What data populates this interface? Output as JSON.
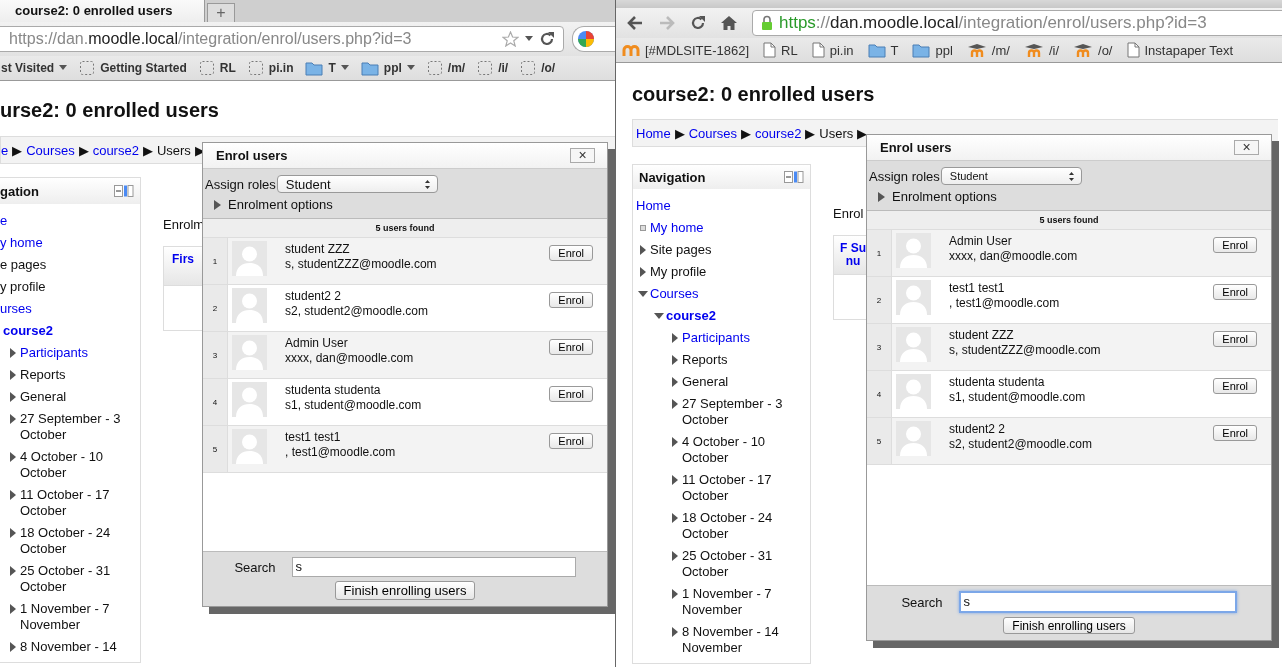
{
  "windows": [
    {
      "tab": {
        "title": "course2: 0 enrolled users"
      },
      "new_tab": "+",
      "address": {
        "secure": false,
        "parts": [
          {
            "text": "https://dan.",
            "kind": "dim"
          },
          {
            "text": "moodle.local",
            "kind": "host"
          },
          {
            "text": "/integration/enrol/users.php?id=3",
            "kind": "dim"
          }
        ]
      },
      "bookmarks": [
        {
          "label": "st Visited",
          "kind": "plain",
          "menu": true
        },
        {
          "label": "Getting Started",
          "kind": "blank",
          "menu": false
        },
        {
          "label": "RL",
          "kind": "blank",
          "menu": false
        },
        {
          "label": "pi.in",
          "kind": "blank",
          "menu": false
        },
        {
          "label": "T",
          "kind": "folder",
          "menu": true
        },
        {
          "label": "ppl",
          "kind": "folder",
          "menu": true
        },
        {
          "label": "/m/",
          "kind": "blank",
          "menu": false
        },
        {
          "label": "/i/",
          "kind": "blank",
          "menu": false
        },
        {
          "label": "/o/",
          "kind": "blank",
          "menu": false
        }
      ],
      "page": {
        "title": "urse2: 0 enrolled users",
        "breadcrumb": {
          "separator": "▶",
          "trailing": true,
          "items": [
            {
              "label": "e",
              "link": true
            },
            {
              "label": "Courses",
              "link": true
            },
            {
              "label": "course2",
              "link": true
            },
            {
              "label": "Users",
              "link": false
            }
          ]
        },
        "nav": {
          "title": "gation",
          "items": [
            {
              "label": "e",
              "kind": "plain",
              "link": true,
              "current": false
            },
            {
              "label": "y home",
              "kind": "plain",
              "link": true,
              "current": false
            },
            {
              "label": "e pages",
              "kind": "plain",
              "link": false,
              "current": false
            },
            {
              "label": "y profile",
              "kind": "plain",
              "link": false,
              "current": false
            },
            {
              "label": "urses",
              "kind": "plain",
              "link": true,
              "current": false,
              "children": [
                {
                  "label": "course2",
                  "kind": "plain",
                  "link": true,
                  "current": true,
                  "children": [
                    {
                      "label": "Participants",
                      "kind": "branch",
                      "expanded": false,
                      "link": true,
                      "current": false
                    },
                    {
                      "label": "Reports",
                      "kind": "branch",
                      "expanded": false,
                      "link": false,
                      "current": false
                    },
                    {
                      "label": "General",
                      "kind": "branch",
                      "expanded": false,
                      "link": false,
                      "current": false
                    },
                    {
                      "label": "27 September - 3 October",
                      "kind": "branch",
                      "expanded": false,
                      "link": false,
                      "current": false
                    },
                    {
                      "label": "4 October - 10 October",
                      "kind": "branch",
                      "expanded": false,
                      "link": false,
                      "current": false
                    },
                    {
                      "label": "11 October - 17 October",
                      "kind": "branch",
                      "expanded": false,
                      "link": false,
                      "current": false
                    },
                    {
                      "label": "18 October - 24 October",
                      "kind": "branch",
                      "expanded": false,
                      "link": false,
                      "current": false
                    },
                    {
                      "label": "25 October - 31 October",
                      "kind": "branch",
                      "expanded": false,
                      "link": false,
                      "current": false
                    },
                    {
                      "label": "1 November - 7 November",
                      "kind": "branch",
                      "expanded": false,
                      "link": false,
                      "current": false
                    },
                    {
                      "label": "8 November - 14",
                      "kind": "branch",
                      "expanded": false,
                      "link": false,
                      "current": false
                    }
                  ]
                }
              ]
            }
          ]
        },
        "content_label": "Enrolm",
        "table_header": "Firs"
      },
      "dialog": {
        "title": "Enrol users",
        "close": "×",
        "assign_label": "Assign roles",
        "role": "Student",
        "options_label": "Enrolment options",
        "options_expanded": false,
        "found": "5 users found",
        "users": [
          {
            "number": "1",
            "name": "student ZZZ",
            "detail": "s, studentZZZ@moodle.com",
            "action": "Enrol"
          },
          {
            "number": "2",
            "name": "student2 2",
            "detail": "s2, student2@moodle.com",
            "action": "Enrol"
          },
          {
            "number": "3",
            "name": "Admin User",
            "detail": "xxxx, dan@moodle.com",
            "action": "Enrol"
          },
          {
            "number": "4",
            "name": "studenta studenta",
            "detail": "s1, student@moodle.com",
            "action": "Enrol"
          },
          {
            "number": "5",
            "name": "test1 test1",
            "detail": ", test1@moodle.com",
            "action": "Enrol"
          }
        ],
        "search_label": "Search",
        "search_value": "s",
        "search_focused": false,
        "finish": "Finish enrolling users"
      }
    },
    {
      "forward_disabled": true,
      "address": {
        "secure": true,
        "parts": [
          {
            "text": "https",
            "kind": "secure"
          },
          {
            "text": "://",
            "kind": "dim"
          },
          {
            "text": "dan.moodle.local",
            "kind": "host"
          },
          {
            "text": "/integration/enrol/users.php?id=3",
            "kind": "dim"
          }
        ]
      },
      "bookmarks": [
        {
          "label": "[#MDLSITE-1862]",
          "kind": "logo",
          "menu": false
        },
        {
          "label": "RL",
          "kind": "page",
          "menu": false
        },
        {
          "label": "pi.in",
          "kind": "page",
          "menu": false
        },
        {
          "label": "T",
          "kind": "folder",
          "menu": false
        },
        {
          "label": "ppl",
          "kind": "folder",
          "menu": false
        },
        {
          "label": "/m/",
          "kind": "hat",
          "menu": false
        },
        {
          "label": "/i/",
          "kind": "hat",
          "menu": false
        },
        {
          "label": "/o/",
          "kind": "hat",
          "menu": false
        },
        {
          "label": "Instapaper Text",
          "kind": "page",
          "menu": false
        }
      ],
      "page": {
        "title": "course2: 0 enrolled users",
        "breadcrumb": {
          "separator": "▶",
          "trailing": true,
          "items": [
            {
              "label": "Home",
              "link": true
            },
            {
              "label": "Courses",
              "link": true
            },
            {
              "label": "course2",
              "link": true
            },
            {
              "label": "Users",
              "link": false
            }
          ]
        },
        "nav": {
          "title": "Navigation",
          "items": [
            {
              "label": "Home",
              "kind": "plain",
              "link": true,
              "current": false
            },
            {
              "label": "My home",
              "kind": "leaf",
              "link": true,
              "current": false
            },
            {
              "label": "Site pages",
              "kind": "branch",
              "expanded": false,
              "link": false,
              "current": false
            },
            {
              "label": "My profile",
              "kind": "branch",
              "expanded": false,
              "link": false,
              "current": false
            },
            {
              "label": "Courses",
              "kind": "branch",
              "expanded": true,
              "link": true,
              "current": false,
              "children": [
                {
                  "label": "course2",
                  "kind": "branch",
                  "expanded": true,
                  "link": true,
                  "current": true,
                  "children": [
                    {
                      "label": "Participants",
                      "kind": "branch",
                      "expanded": false,
                      "link": true,
                      "current": false
                    },
                    {
                      "label": "Reports",
                      "kind": "branch",
                      "expanded": false,
                      "link": false,
                      "current": false
                    },
                    {
                      "label": "General",
                      "kind": "branch",
                      "expanded": false,
                      "link": false,
                      "current": false
                    },
                    {
                      "label": "27 September - 3 October",
                      "kind": "branch",
                      "expanded": false,
                      "link": false,
                      "current": false
                    },
                    {
                      "label": "4 October - 10 October",
                      "kind": "branch",
                      "expanded": false,
                      "link": false,
                      "current": false
                    },
                    {
                      "label": "11 October - 17 October",
                      "kind": "branch",
                      "expanded": false,
                      "link": false,
                      "current": false
                    },
                    {
                      "label": "18 October - 24 October",
                      "kind": "branch",
                      "expanded": false,
                      "link": false,
                      "current": false
                    },
                    {
                      "label": "25 October - 31 October",
                      "kind": "branch",
                      "expanded": false,
                      "link": false,
                      "current": false
                    },
                    {
                      "label": "1 November - 7 November",
                      "kind": "branch",
                      "expanded": false,
                      "link": false,
                      "current": false
                    },
                    {
                      "label": "8 November - 14 November",
                      "kind": "branch",
                      "expanded": false,
                      "link": false,
                      "current": false
                    }
                  ]
                }
              ]
            }
          ]
        },
        "content_label": "Enrol",
        "table_header": "F Su nu"
      },
      "dialog": {
        "title": "Enrol users",
        "close": "×",
        "assign_label": "Assign roles",
        "role": "Student",
        "options_label": "Enrolment options",
        "options_expanded": false,
        "found": "5 users found",
        "users": [
          {
            "number": "1",
            "name": "Admin User",
            "detail": "xxxx, dan@moodle.com",
            "action": "Enrol"
          },
          {
            "number": "2",
            "name": "test1 test1",
            "detail": ", test1@moodle.com",
            "action": "Enrol"
          },
          {
            "number": "3",
            "name": "student ZZZ",
            "detail": "s, studentZZZ@moodle.com",
            "action": "Enrol"
          },
          {
            "number": "4",
            "name": "studenta studenta",
            "detail": "s1, student@moodle.com",
            "action": "Enrol"
          },
          {
            "number": "5",
            "name": "student2 2",
            "detail": "s2, student2@moodle.com",
            "action": "Enrol"
          }
        ],
        "search_label": "Search",
        "search_value": "s",
        "search_focused": true,
        "finish": "Finish enrolling users"
      }
    }
  ]
}
